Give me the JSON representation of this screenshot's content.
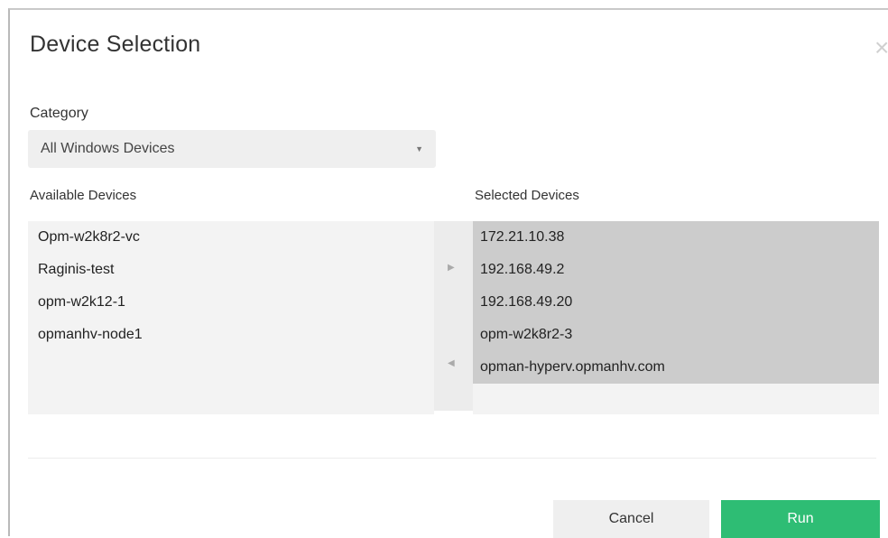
{
  "dialog": {
    "title": "Device Selection",
    "close_icon": "close-icon"
  },
  "category": {
    "label": "Category",
    "selected": "All Windows Devices",
    "caret_icon": "caret-down-icon"
  },
  "available": {
    "label": "Available Devices",
    "items": [
      "Opm-w2k8r2-vc",
      "Raginis-test",
      "opm-w2k12-1",
      "opmanhv-node1"
    ]
  },
  "selected": {
    "label": "Selected Devices",
    "items": [
      "172.21.10.38",
      "192.168.49.2",
      "192.168.49.20",
      "opm-w2k8r2-3",
      "opman-hyperv.opmanhv.com"
    ]
  },
  "mover": {
    "add_icon": "arrow-right-icon",
    "remove_icon": "arrow-left-icon"
  },
  "buttons": {
    "cancel": "Cancel",
    "run": "Run"
  },
  "colors": {
    "run_button": "#2ebd74",
    "selected_highlight": "#cccccc"
  }
}
